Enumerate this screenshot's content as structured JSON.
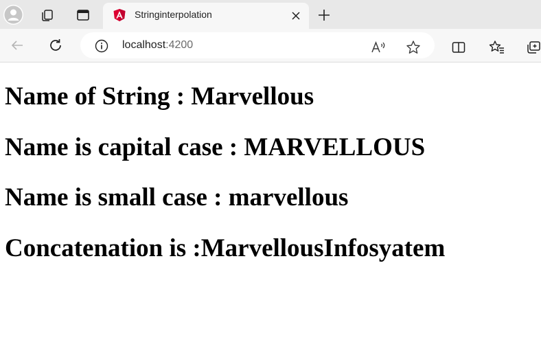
{
  "tab": {
    "title": "Stringinterpolation",
    "favicon_icon": "angular-icon",
    "accent_color": "#dd0031"
  },
  "toolbar": {
    "url_host": "localhost",
    "url_port": ":4200"
  },
  "page": {
    "lines": [
      "Name of String : Marvellous",
      "Name is capital case : MARVELLOUS",
      "Name is small case : marvellous",
      "Concatenation is :MarvellousInfosyatem"
    ]
  },
  "colors": {
    "tabstrip_bg": "#e8e8e8",
    "toolbar_bg": "#f7f7f7",
    "page_bg": "#ffffff",
    "text": "#000000"
  }
}
